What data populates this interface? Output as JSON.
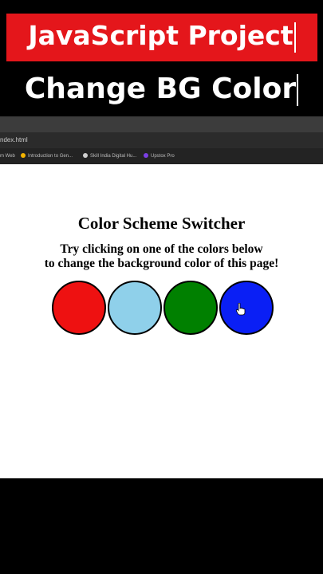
{
  "overlay": {
    "title": "JavaScript Project",
    "subtitle": "Change BG Color",
    "title_bg": "#e4161b"
  },
  "browser": {
    "address": "ndex.html",
    "bookmarks": [
      {
        "label": "m Web",
        "icon_color": "#9e9e9e"
      },
      {
        "label": "Introduction to Gen...",
        "icon_color": "#f4b400"
      },
      {
        "label": "Skill India Digital Hu...",
        "icon_color": "#cfcfcf"
      },
      {
        "label": "Upstox Pro",
        "icon_color": "#7b3fe4"
      }
    ]
  },
  "page": {
    "heading": "Color Scheme Switcher",
    "instruction_line1": "Try clicking on one of the colors below",
    "instruction_line2": "to change the background color of this page!",
    "background": "#ffffff",
    "swatches": [
      {
        "name": "red",
        "color": "#ee1111"
      },
      {
        "name": "light-blue",
        "color": "#8fd0ea"
      },
      {
        "name": "green",
        "color": "#008000"
      },
      {
        "name": "blue",
        "color": "#0a1ff5"
      }
    ]
  }
}
